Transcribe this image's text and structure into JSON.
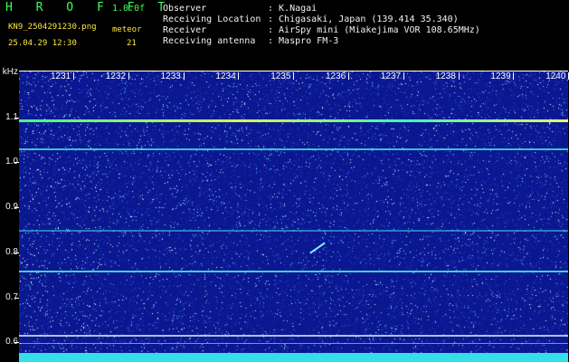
{
  "header": {
    "app_name": "H R O F F T",
    "version": "1.0.0f",
    "filename": "KN9_2504291230.png",
    "meteor_label": "meteor",
    "meteor_count": "21",
    "datetime": "25.04.29 12:30",
    "fields": [
      {
        "label": "Observer",
        "value": ": K.Nagai"
      },
      {
        "label": "Receiving Location",
        "value": ": Chigasaki, Japan (139.414 35.340)"
      },
      {
        "label": "Receiver",
        "value": ": AirSpy mini (Miakejima VOR 108.65MHz)"
      },
      {
        "label": "Receiving antenna",
        "value": ": Maspro FM-3"
      }
    ]
  },
  "axes": {
    "y_unit": "kHz",
    "y_labels": [
      "1.1",
      "1.0",
      "0.9",
      "0.8",
      "0.7",
      "0.6"
    ],
    "x_labels": [
      "1231",
      "1232",
      "1233",
      "1234",
      "1235",
      "1236",
      "1237",
      "1238",
      "1239",
      "1240"
    ]
  },
  "colors": {
    "background": "#0b1790",
    "carrier": "#3dff9a",
    "tone": "#40e8e0",
    "text_green": "#3dff5a",
    "text_yellow": "#ffea3a"
  }
}
